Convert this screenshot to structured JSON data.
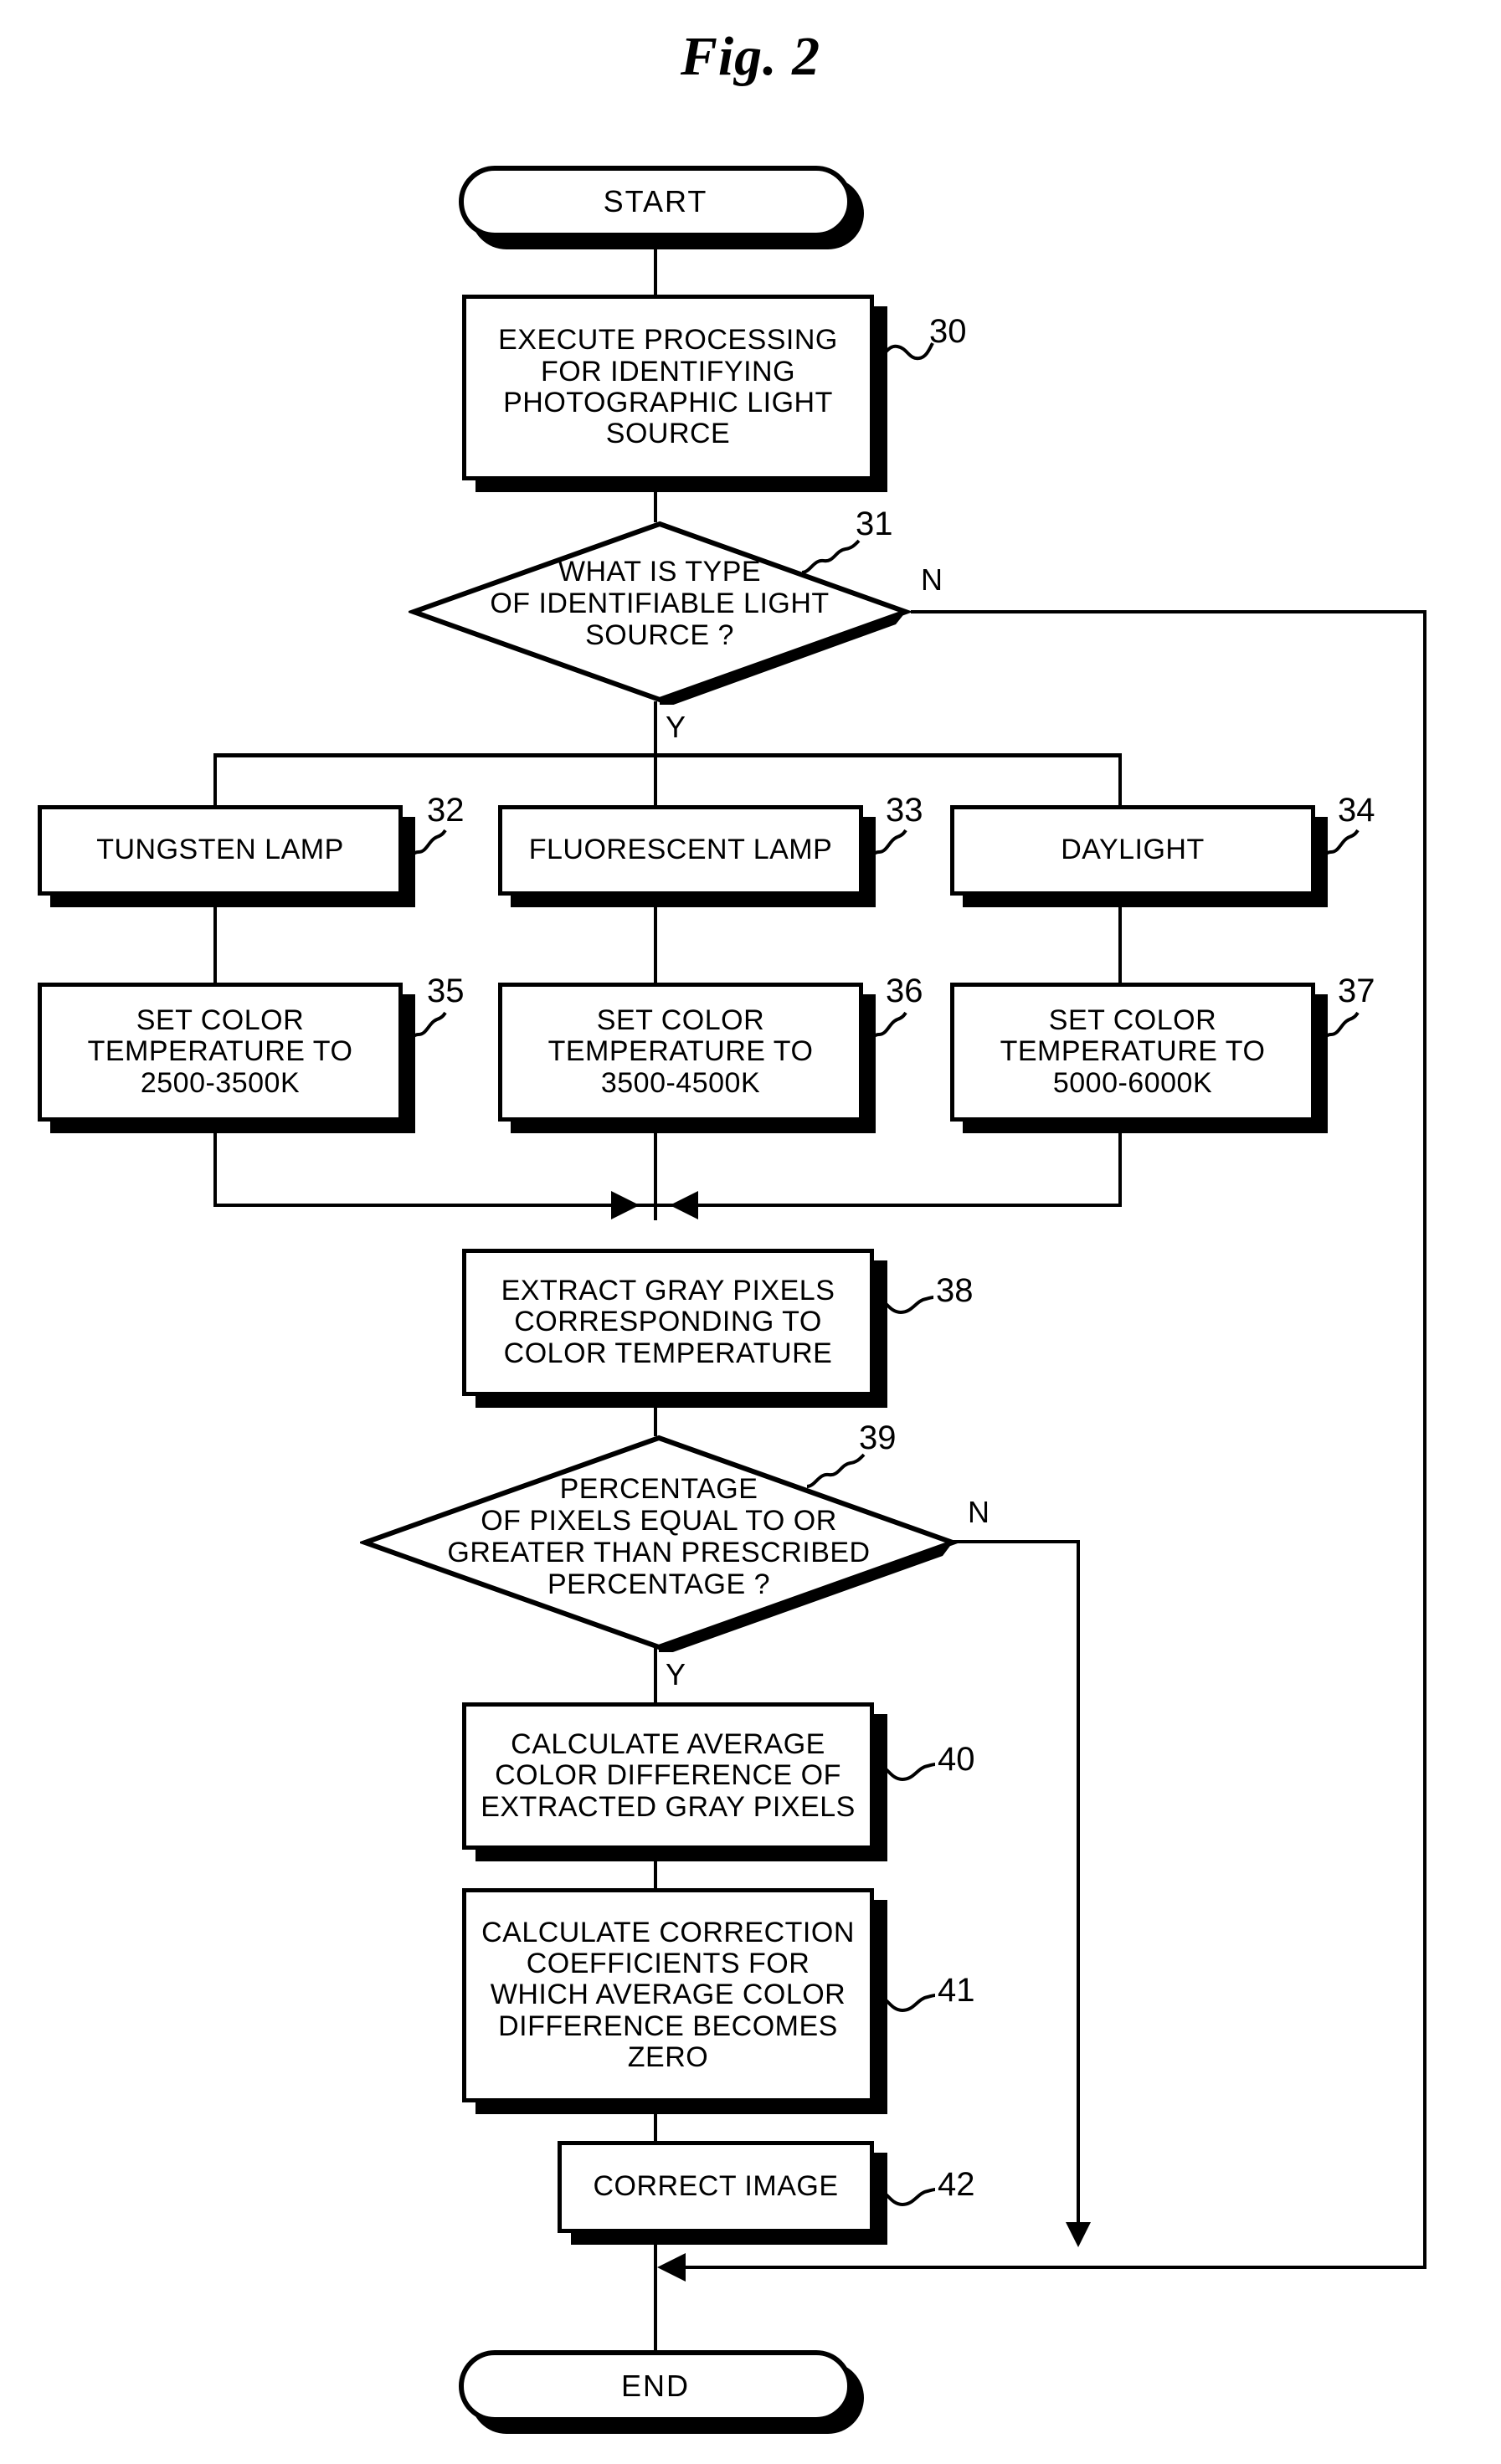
{
  "figure": {
    "title": "Fig. 2"
  },
  "flowchart": {
    "type": "flowchart",
    "nodes": [
      {
        "id": "start",
        "shape": "terminal",
        "label": "START",
        "ref": ""
      },
      {
        "id": "n30",
        "shape": "process",
        "label": "EXECUTE PROCESSING\nFOR IDENTIFYING\nPHOTOGRAPHIC LIGHT\nSOURCE",
        "ref": "30"
      },
      {
        "id": "n31",
        "shape": "decision",
        "label": "WHAT IS TYPE\nOF IDENTIFIABLE LIGHT\nSOURCE ?",
        "ref": "31"
      },
      {
        "id": "n32",
        "shape": "process",
        "label": "TUNGSTEN LAMP",
        "ref": "32"
      },
      {
        "id": "n33",
        "shape": "process",
        "label": "FLUORESCENT LAMP",
        "ref": "33"
      },
      {
        "id": "n34",
        "shape": "process",
        "label": "DAYLIGHT",
        "ref": "34"
      },
      {
        "id": "n35",
        "shape": "process",
        "label": "SET COLOR\nTEMPERATURE TO\n2500-3500K",
        "ref": "35"
      },
      {
        "id": "n36",
        "shape": "process",
        "label": "SET COLOR\nTEMPERATURE TO\n3500-4500K",
        "ref": "36"
      },
      {
        "id": "n37",
        "shape": "process",
        "label": "SET COLOR\nTEMPERATURE TO\n5000-6000K",
        "ref": "37"
      },
      {
        "id": "n38",
        "shape": "process",
        "label": "EXTRACT GRAY PIXELS\nCORRESPONDING TO\nCOLOR TEMPERATURE",
        "ref": "38"
      },
      {
        "id": "n39",
        "shape": "decision",
        "label": "PERCENTAGE\nOF PIXELS EQUAL TO OR\nGREATER THAN PRESCRIBED\nPERCENTAGE ?",
        "ref": "39"
      },
      {
        "id": "n40",
        "shape": "process",
        "label": "CALCULATE AVERAGE\nCOLOR DIFFERENCE OF\nEXTRACTED GRAY PIXELS",
        "ref": "40"
      },
      {
        "id": "n41",
        "shape": "process",
        "label": "CALCULATE CORRECTION\nCOEFFICIENTS FOR\nWHICH AVERAGE COLOR\nDIFFERENCE BECOMES\nZERO",
        "ref": "41"
      },
      {
        "id": "n42",
        "shape": "process",
        "label": "CORRECT IMAGE",
        "ref": "42"
      },
      {
        "id": "end",
        "shape": "terminal",
        "label": "END",
        "ref": ""
      }
    ],
    "branch_labels": {
      "d31_yes": "Y",
      "d31_no": "N",
      "d39_yes": "Y",
      "d39_no": "N"
    },
    "colors": {
      "ink": "#000000",
      "paper": "#ffffff"
    }
  }
}
